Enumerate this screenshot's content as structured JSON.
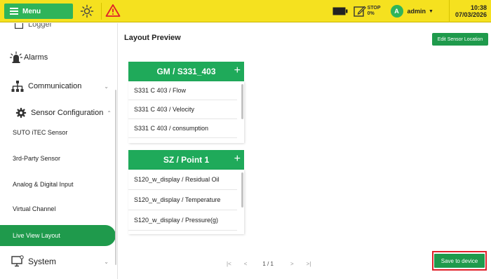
{
  "topbar": {
    "menu_label": "Menu",
    "stop_label": "STOP",
    "stop_value": "0%",
    "user_initial": "A",
    "user_name": "admin",
    "time": "10:38",
    "date": "07/03/2026"
  },
  "sidebar": {
    "partial_top": "Logger",
    "alarms": "Alarms",
    "communication": "Communication",
    "sensor_configuration": "Sensor Configuration",
    "sub_items": [
      "SUTO iTEC Sensor",
      "3rd-Party Sensor",
      "Analog & Digital Input",
      "Virtual Channel",
      "Live View Layout"
    ],
    "system": "System"
  },
  "main": {
    "title": "Layout Preview",
    "edit_button": "Edit Sensor Location",
    "groups": [
      {
        "title": "GM / S331_403",
        "channels": [
          "S331 C 403 / Flow",
          "S331 C 403 / Velocity",
          "S331 C 403 / consumption"
        ]
      },
      {
        "title": "SZ / Point 1",
        "channels": [
          "S120_w_display / Residual Oil",
          "S120_w_display / Temperature",
          "S120_w_display / Pressure(g)"
        ]
      }
    ],
    "pager_text": "1 / 1",
    "save_button": "Save to device"
  },
  "colors": {
    "topbar": "#f5e11f",
    "accent_green": "#1f9a4c",
    "highlight_red": "#e0202a"
  },
  "icons": [
    "menu-icon",
    "sun-icon",
    "warning-icon",
    "battery-icon",
    "stop-edit-icon",
    "avatar",
    "alarm-icon",
    "network-icon",
    "gear-icon",
    "monitor-icon"
  ]
}
